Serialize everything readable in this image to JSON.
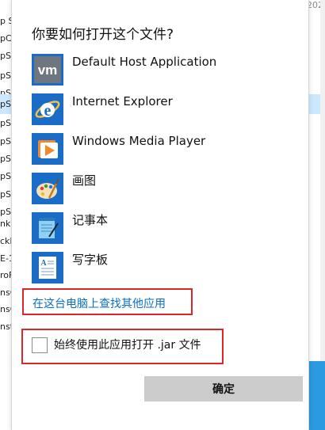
{
  "dialog": {
    "title": "你要如何打开这个文件?",
    "apps": [
      {
        "label": "Default Host Application",
        "icon": "vmware-icon"
      },
      {
        "label": "Internet Explorer",
        "icon": "internet-explorer-icon"
      },
      {
        "label": "Windows Media Player",
        "icon": "windows-media-player-icon"
      },
      {
        "label": "画图",
        "icon": "paint-icon"
      },
      {
        "label": "记事本",
        "icon": "notepad-icon"
      },
      {
        "label": "写字板",
        "icon": "wordpad-icon"
      }
    ],
    "more_apps_link": "在这台电脑上查找其他应用",
    "always_use_label": "始终使用此应用打开 .jar 文件",
    "always_use_checked": false,
    "ok_label": "确定"
  },
  "background": {
    "left_fragments": [
      "p S",
      "pC",
      "pS",
      "pS",
      "pS",
      "pS",
      "pS",
      "pS",
      "pS",
      "pS",
      "pS",
      "pS",
      "nk",
      "ckE",
      "E-1",
      "roF",
      "nsC",
      "nsC",
      "nst"
    ],
    "right_date": "202"
  },
  "colors": {
    "link": "#0a6fc2",
    "highlight_border": "#e0242b",
    "ok_button_bg": "#cccccc",
    "selection": "#cce8ff",
    "accent": "#2b9ae0"
  }
}
